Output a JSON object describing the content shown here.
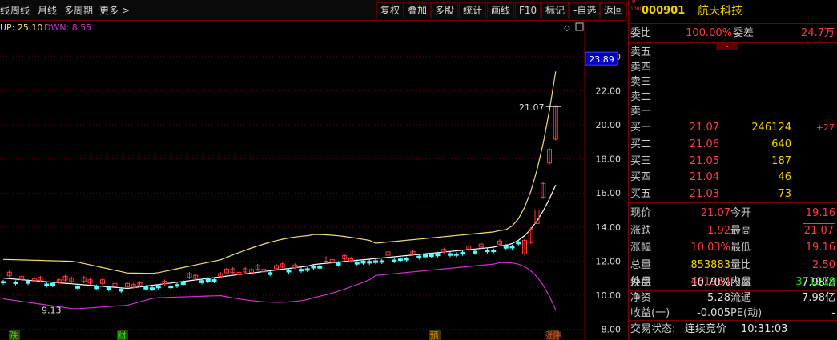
{
  "toolbar": {
    "left_items": [
      "线",
      "周线",
      "月线",
      "多周期",
      "更多 >"
    ],
    "right_items": [
      "复权",
      "叠加",
      "多股",
      "统计",
      "画线",
      "F10",
      "标记",
      "-自选",
      "返回"
    ]
  },
  "chart": {
    "indicator_up": "UP: 25.10",
    "indicator_dwn": "DWN: 8.55",
    "current_price_tag": "23.89",
    "y_ticks": [
      "24.00",
      "22.00",
      "20.00",
      "18.00",
      "16.00",
      "14.00",
      "12.00",
      "10.00",
      "8.00"
    ],
    "high_annotation": "21.07",
    "low_annotation": "9.13",
    "event_markers": [
      "跌",
      "财",
      "预",
      "涨停"
    ],
    "colors": {
      "up": "#ff3b3b",
      "down": "#54ffff",
      "upper_band": "#f0e070",
      "mid_band": "#ffffff",
      "lower_band": "#d030d0",
      "grid": "#6a0000"
    }
  },
  "quote": {
    "code": "000901",
    "name": "航天科技",
    "badge_top": "R",
    "badge_bottom": "1000",
    "weibi_label": "委比",
    "weibi_value": "100.00%",
    "weicha_label": "委差",
    "weicha_value": "24.7万",
    "sell_rows": [
      {
        "label": "卖五"
      },
      {
        "label": "卖四"
      },
      {
        "label": "卖三"
      },
      {
        "label": "卖二"
      },
      {
        "label": "卖一"
      }
    ],
    "buy_rows": [
      {
        "label": "买一",
        "price": "21.07",
        "vol": "246124",
        "chg": "+27"
      },
      {
        "label": "买二",
        "price": "21.06",
        "vol": "640",
        "chg": ""
      },
      {
        "label": "买三",
        "price": "21.05",
        "vol": "187",
        "chg": ""
      },
      {
        "label": "买四",
        "price": "21.04",
        "vol": "46",
        "chg": ""
      },
      {
        "label": "买五",
        "price": "21.03",
        "vol": "73",
        "chg": ""
      }
    ],
    "stats": [
      {
        "l1": "现价",
        "v1": "21.07",
        "c1": "red",
        "l2": "今开",
        "v2": "19.16",
        "c2": "red"
      },
      {
        "l1": "涨跌",
        "v1": "1.92",
        "c1": "red",
        "l2": "最高",
        "v2": "21.07",
        "c2": "red"
      },
      {
        "l1": "涨幅",
        "v1": "10.03%",
        "c1": "red",
        "l2": "最低",
        "v2": "19.16",
        "c2": "red"
      },
      {
        "l1": "总量",
        "v1": "853883",
        "c1": "yellow",
        "l2": "量比",
        "v2": "2.50",
        "c2": "red"
      },
      {
        "l1": "外盘",
        "v1": "481964",
        "c1": "red",
        "l2": "内盘",
        "v2": "371919",
        "c2": "green"
      }
    ],
    "stats2": [
      {
        "l1": "换手",
        "v1": "10.70%",
        "l2": "股本",
        "v2": "7.98亿"
      },
      {
        "l1": "净资",
        "v1": "5.28",
        "l2": "流通",
        "v2": "7.98亿"
      },
      {
        "l1": "收益(一)",
        "v1": "-0.005",
        "l2": "PE(动)",
        "v2": "-"
      }
    ],
    "status_label": "交易状态:",
    "status_value": "连续竞价",
    "status_time": "10:31:03"
  }
}
